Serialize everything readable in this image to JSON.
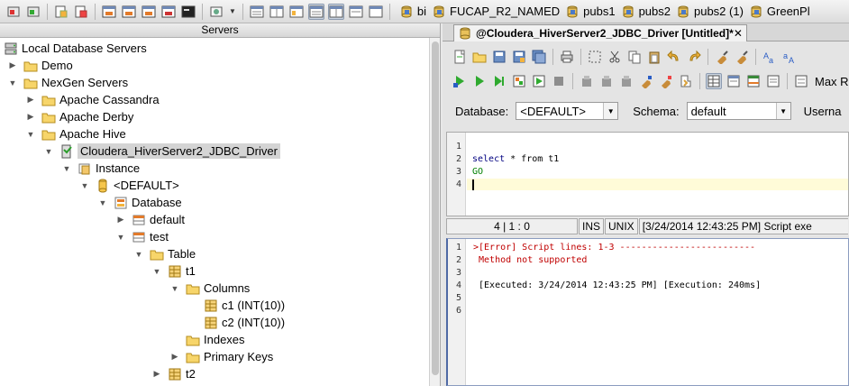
{
  "toolbar": {
    "connections": [
      {
        "label": "bi"
      },
      {
        "label": "FUCAP_R2_NAMED"
      },
      {
        "label": "pubs1"
      },
      {
        "label": "pubs2"
      },
      {
        "label": "pubs2 (1)"
      },
      {
        "label": "GreenPl"
      }
    ]
  },
  "servers_panel": {
    "title": "Servers",
    "tree": [
      {
        "label": "Local Database Servers",
        "icon": "servers-icon",
        "expanded": true
      },
      {
        "label": "Demo",
        "icon": "folder-icon",
        "expanded": false
      },
      {
        "label": "NexGen Servers",
        "icon": "folder-icon",
        "expanded": true
      },
      {
        "label": "Apache Cassandra",
        "icon": "folder-icon",
        "expanded": false
      },
      {
        "label": "Apache Derby",
        "icon": "folder-icon",
        "expanded": false
      },
      {
        "label": "Apache Hive",
        "icon": "folder-icon",
        "expanded": true
      },
      {
        "label": "Cloudera_HiverServer2_JDBC_Driver",
        "icon": "server-connected-icon",
        "expanded": true,
        "selected": true
      },
      {
        "label": "Instance",
        "icon": "instance-icon",
        "expanded": true
      },
      {
        "label": "<DEFAULT>",
        "icon": "cylinder-icon",
        "expanded": true
      },
      {
        "label": "Database",
        "icon": "database-icon",
        "expanded": true
      },
      {
        "label": "default",
        "icon": "schema-icon",
        "expanded": false
      },
      {
        "label": "test",
        "icon": "schema-icon",
        "expanded": true
      },
      {
        "label": "Table",
        "icon": "folder-icon",
        "expanded": true
      },
      {
        "label": "t1",
        "icon": "table-icon",
        "expanded": true
      },
      {
        "label": "Columns",
        "icon": "folder-icon",
        "expanded": true
      },
      {
        "label": "c1 (INT(10))",
        "icon": "column-icon",
        "leaf": true
      },
      {
        "label": "c2 (INT(10))",
        "icon": "column-icon",
        "leaf": true
      },
      {
        "label": "Indexes",
        "icon": "folder-icon",
        "leaf": true
      },
      {
        "label": "Primary Keys",
        "icon": "folder-icon",
        "expanded": false
      },
      {
        "label": "t2",
        "icon": "table-icon",
        "expanded": false
      }
    ]
  },
  "editor": {
    "tab_title": "@Cloudera_HiverServer2_JDBC_Driver [Untitled]*",
    "tab_close": "✕",
    "max_results_label": "Max Result",
    "database_label": "Database:",
    "database_value": "<DEFAULT>",
    "schema_label": "Schema:",
    "schema_value": "default",
    "username_label": "Userna",
    "line_numbers": [
      "1",
      "2",
      "3",
      "4"
    ],
    "code": {
      "select_kw": "select",
      "rest": " * from t1",
      "go": "GO"
    },
    "status": {
      "position": "4 | 1 : 0",
      "mode": "INS",
      "eol": "UNIX",
      "message": "[3/24/2014 12:43:25 PM] Script exe"
    }
  },
  "output": {
    "line_numbers": [
      "1",
      "2",
      "3",
      "4",
      "5",
      "6"
    ],
    "lines": [
      ">[Error] Script lines: 1-3 -------------------------",
      " Method not supported",
      "",
      " [Executed: 3/24/2014 12:43:25 PM] [Execution: 240ms]",
      "",
      ""
    ]
  }
}
